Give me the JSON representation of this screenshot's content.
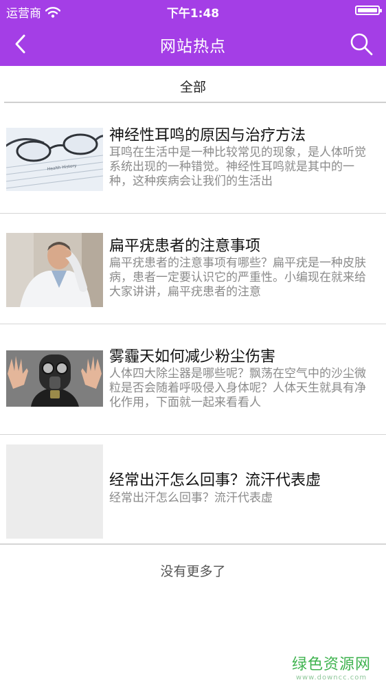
{
  "status_bar": {
    "carrier": "运营商",
    "time": "下午1:48"
  },
  "nav": {
    "title": "网站热点"
  },
  "tabs": [
    {
      "label": "全部"
    }
  ],
  "articles": [
    {
      "title": "神经性耳鸣的原因与治疗方法",
      "summary": "耳鸣在生活中是一种比较常见的现象，是人体听觉系统出现的一种错觉。神经性耳鸣就是其中的一种，这种疾病会让我们的生活出"
    },
    {
      "title": "扁平疣患者的注意事项",
      "summary": "扁平疣患者的注意事项有哪些？扁平疣是一种皮肤病，患者一定要认识它的严重性。小编现在就来给大家讲讲，扁平疣患者的注意"
    },
    {
      "title": "雾霾天如何减少粉尘伤害",
      "summary": "人体四大除尘器是哪些呢？飘荡在空气中的沙尘微粒是否会随着呼吸侵入身体呢？人体天生就具有净化作用，下面就一起来看看人"
    },
    {
      "title": "经常出汗怎么回事？流汗代表虚",
      "summary": "经常出汗怎么回事？流汗代表虚"
    }
  ],
  "footer": {
    "text": "没有更多了"
  },
  "watermark": {
    "name": "绿色资源网",
    "url": "www.downcc.com"
  },
  "colors": {
    "nav_background": "#a43ee6",
    "title_text": "#111111",
    "summary_text": "#8a8a8a",
    "watermark": "#3fb34f"
  }
}
